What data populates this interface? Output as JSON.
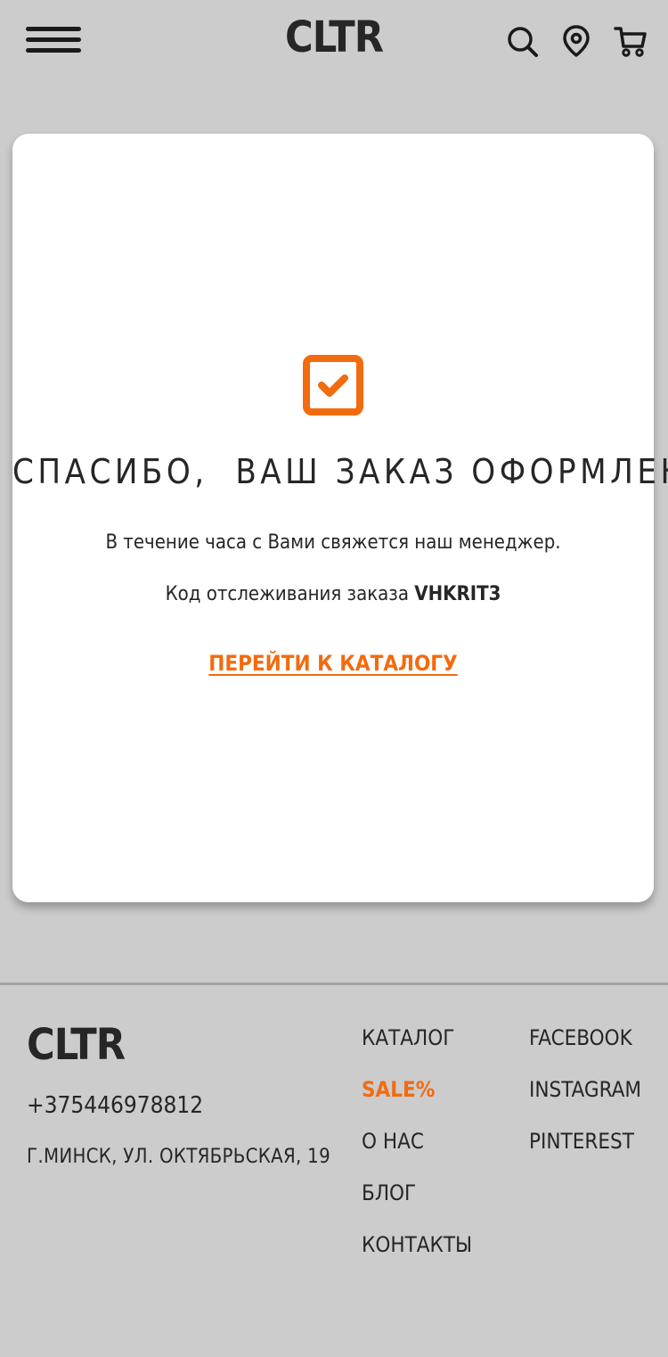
{
  "header": {
    "logo": "CLTR"
  },
  "confirmation": {
    "title": "СПАСИБО,  ВАШ ЗАКАЗ ОФОРМЛЕН",
    "message": "В течение часа с Вами свяжется наш менеджер.",
    "tracking_label": "Код отслеживания заказа",
    "tracking_code": "VHKRIT3",
    "catalog_link": "ПЕРЕЙТИ К КАТАЛОГУ"
  },
  "footer": {
    "logo": "CLTR",
    "phone": "+375446978812",
    "address": "Г.МИНСК, УЛ. ОКТЯБРЬСКАЯ, 19",
    "menu": [
      "КАТАЛОГ",
      "SALE%",
      "О НАС",
      "БЛОГ",
      "КОНТАКТЫ"
    ],
    "social": [
      "FACEBOOK",
      "INSTAGRAM",
      "PINTEREST"
    ]
  },
  "colors": {
    "accent": "#f26b0f",
    "background": "#cccccc",
    "text": "#262626"
  },
  "icons": [
    "menu-icon",
    "search-icon",
    "location-icon",
    "cart-icon",
    "checkbox-checked-icon"
  ]
}
